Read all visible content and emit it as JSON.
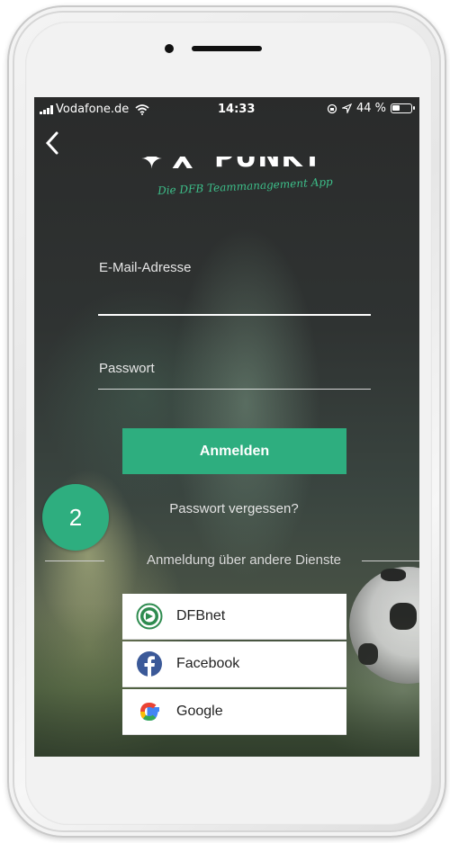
{
  "status_bar": {
    "carrier": "Vodafone.de",
    "time": "14:33",
    "battery": "44 %",
    "battery_level": 0.44
  },
  "brand": {
    "logo_text": "PUNKT",
    "tagline": "Die DFB Teammanagement App"
  },
  "form": {
    "email_label": "E-Mail-Adresse",
    "password_label": "Passwort",
    "login_button": "Anmelden",
    "forgot_password": "Passwort vergessen?"
  },
  "other_services": {
    "heading": "Anmeldung über andere Dienste",
    "items": [
      {
        "label": "DFBnet",
        "icon": "dfb-icon"
      },
      {
        "label": "Facebook",
        "icon": "facebook-icon"
      },
      {
        "label": "Google",
        "icon": "google-icon"
      }
    ]
  },
  "step_badge": "2",
  "colors": {
    "accent": "#2eae7f",
    "facebook": "#3b5998",
    "tagline": "#3dbf8a"
  }
}
